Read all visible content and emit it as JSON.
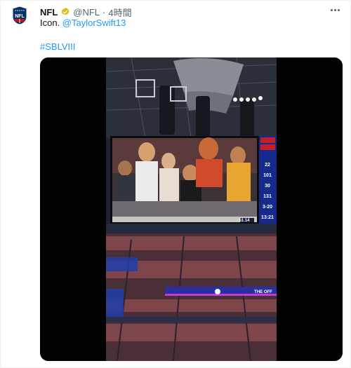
{
  "account": {
    "name": "NFL",
    "handle": "@NFL",
    "separator": "·",
    "time": "4時間",
    "avatar_text": "NFL"
  },
  "tweet": {
    "text_prefix": "Icon. ",
    "mention": "@TaylorSwift13",
    "hashtag": "#SBLVIII"
  },
  "media": {
    "type": "video",
    "scoreboard": {
      "values": [
        "22",
        "101",
        "30",
        "131",
        "3-20",
        "13:21"
      ]
    },
    "jumbotron_counter": "51.14",
    "ribbon_text": "THE OFF"
  },
  "colors": {
    "accent": "#1d9bf0",
    "verified": "#e2b719",
    "nfl_blue": "#013369",
    "nfl_red": "#d50a0a"
  },
  "icons": {
    "verified": "verified-badge-icon",
    "more": "more-options-icon",
    "logo": "nfl-shield-logo"
  }
}
